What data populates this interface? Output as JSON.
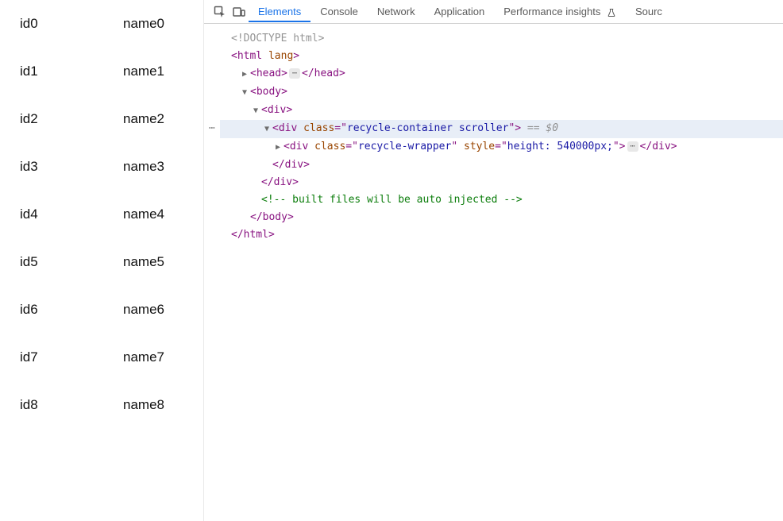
{
  "list": {
    "rows": [
      {
        "id": "id0",
        "name": "name0"
      },
      {
        "id": "id1",
        "name": "name1"
      },
      {
        "id": "id2",
        "name": "name2"
      },
      {
        "id": "id3",
        "name": "name3"
      },
      {
        "id": "id4",
        "name": "name4"
      },
      {
        "id": "id5",
        "name": "name5"
      },
      {
        "id": "id6",
        "name": "name6"
      },
      {
        "id": "id7",
        "name": "name7"
      },
      {
        "id": "id8",
        "name": "name8"
      }
    ]
  },
  "devtools": {
    "tabs": {
      "elements": "Elements",
      "console": "Console",
      "network": "Network",
      "application": "Application",
      "performance_insights": "Performance insights",
      "sources": "Sourc"
    },
    "flask_glyph": "⚗",
    "dom": {
      "doctype": "<!DOCTYPE html>",
      "html_open": "html",
      "html_lang_attr": "lang",
      "head_tag": "head",
      "body_tag": "body",
      "div_tag": "div",
      "class_attr": "class",
      "style_attr": "style",
      "recycle_container_class": "recycle-container scroller",
      "recycle_wrapper_class": "recycle-wrapper",
      "recycle_wrapper_style": "height: 540000px;",
      "selected_hint": "== $0",
      "comment_text": " built files will be auto injected ",
      "html_close": "html"
    }
  }
}
